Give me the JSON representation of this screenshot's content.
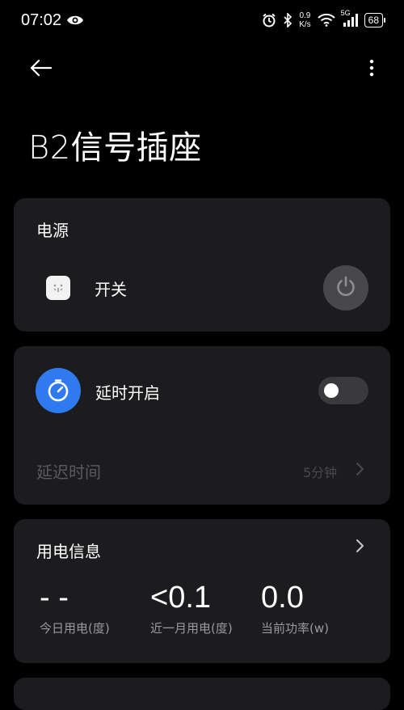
{
  "status": {
    "time": "07:02",
    "net_speed_value": "0.9",
    "net_speed_unit": "K/s",
    "network_type": "5G",
    "battery": "68"
  },
  "page": {
    "title": "B2信号插座"
  },
  "power": {
    "section_title": "电源",
    "switch_label": "开关"
  },
  "timer": {
    "label": "延时开启",
    "delay_label": "延迟时间",
    "delay_value": "5分钟",
    "enabled": false
  },
  "usage": {
    "title": "用电信息",
    "metrics": [
      {
        "value": "- -",
        "label": "今日用电(度)"
      },
      {
        "value": "<0.1",
        "label": "近一月用电(度)"
      },
      {
        "value": "0.0",
        "label": "当前功率(w)"
      }
    ]
  },
  "icons": {
    "eye": "eye-icon",
    "alarm": "alarm-icon",
    "bluetooth": "bluetooth-icon",
    "wifi": "wifi-icon",
    "signal": "signal-icon",
    "back": "back-arrow-icon",
    "more": "more-vertical-icon",
    "plug": "socket-icon",
    "power": "power-icon",
    "timer": "timer-icon",
    "chevron": "chevron-right-icon"
  },
  "colors": {
    "background": "#000000",
    "card": "#1c1c1e",
    "accent": "#2f7af0",
    "muted_text": "#9a9a9e"
  }
}
